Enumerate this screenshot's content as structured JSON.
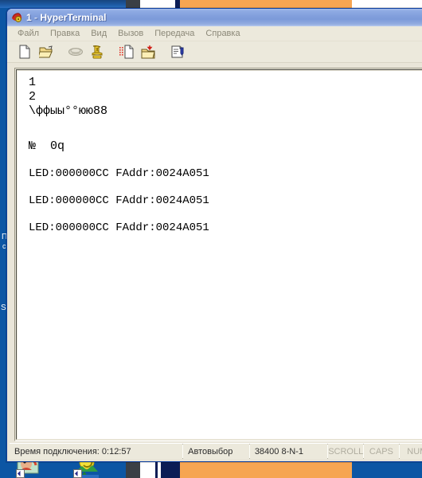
{
  "window": {
    "title_number": "1",
    "title_dash": "-",
    "title_app": "HyperTerminal",
    "app_icon": "phone-modem-icon"
  },
  "menubar": {
    "items": [
      {
        "label": "Файл",
        "name": "menu-file"
      },
      {
        "label": "Правка",
        "name": "menu-edit"
      },
      {
        "label": "Вид",
        "name": "menu-view"
      },
      {
        "label": "Вызов",
        "name": "menu-call"
      },
      {
        "label": "Передача",
        "name": "menu-transfer"
      },
      {
        "label": "Справка",
        "name": "menu-help"
      }
    ]
  },
  "toolbar": {
    "buttons": [
      {
        "name": "new-connection-button",
        "icon": "new-document-icon",
        "enabled": true
      },
      {
        "name": "open-connection-button",
        "icon": "open-folder-icon",
        "enabled": true
      },
      {
        "name": "call-button",
        "icon": "modem-icon",
        "enabled": false
      },
      {
        "name": "disconnect-button",
        "icon": "telephone-icon",
        "enabled": true
      },
      {
        "name": "send-file-button",
        "icon": "send-document-icon",
        "enabled": true
      },
      {
        "name": "receive-file-button",
        "icon": "receive-folder-icon",
        "enabled": true
      },
      {
        "name": "properties-button",
        "icon": "properties-icon",
        "enabled": true
      }
    ]
  },
  "terminal": {
    "lines": [
      "1",
      "2",
      "\\ффыы°°юю88",
      "",
      "№  0q",
      "",
      "LED:000000CC FAddr:0024A051",
      "",
      "LED:000000CC FAddr:0024A051",
      "",
      "LED:000000CC FAddr:0024A051"
    ]
  },
  "statusbar": {
    "connection_time": "Время подключения: 0:12:57",
    "detect": "Автовыбор",
    "baud": "38400 8-N-1",
    "scroll": "SCROLL",
    "caps": "CAPS",
    "num": "NUM"
  },
  "desktop": {
    "labels": [
      {
        "text": "П",
        "name": "desktop-label-top-1"
      },
      {
        "text": "с",
        "name": "desktop-label-top-2"
      },
      {
        "text": "Sa",
        "name": "desktop-label-bottom-1"
      }
    ]
  },
  "colors": {
    "title_bar": "#829fdd",
    "window_face": "#ece9dc",
    "desktop": "#0c56a4",
    "terminal_bg": "#ffffff",
    "terminal_fg": "#000000",
    "accent_orange": "#f6a552"
  }
}
